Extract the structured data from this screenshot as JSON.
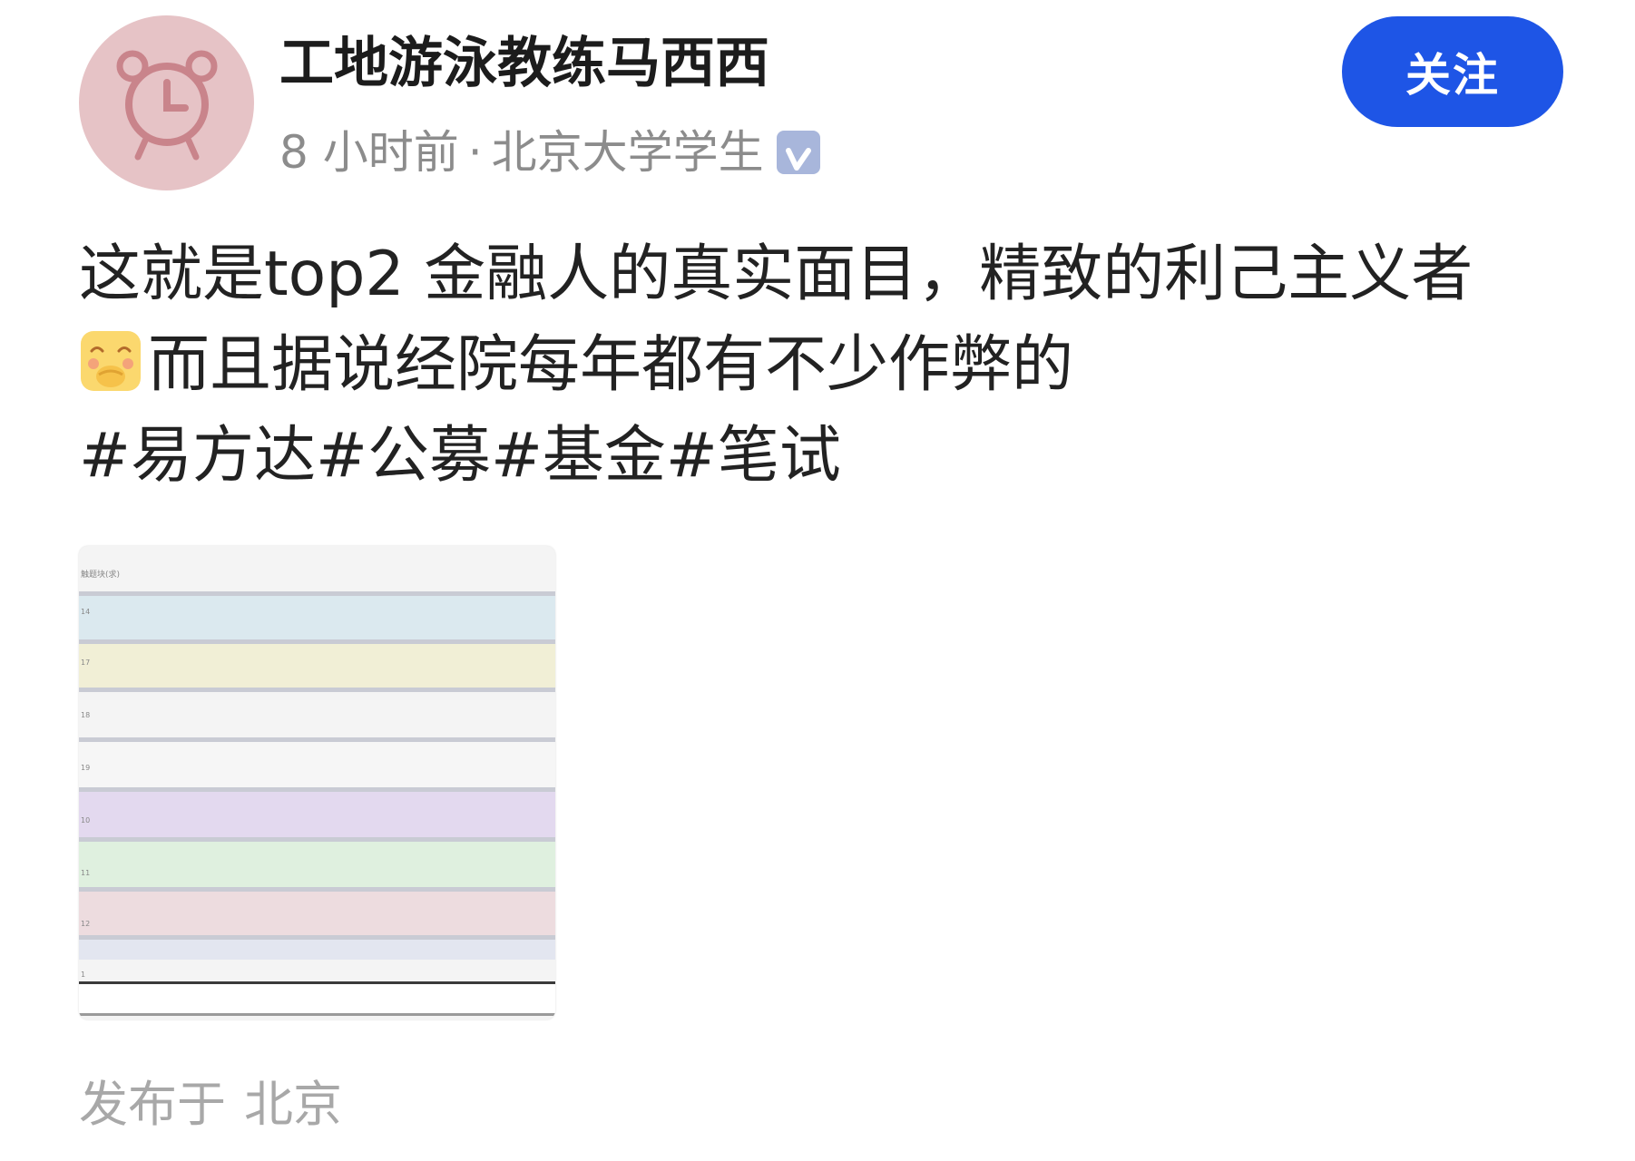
{
  "author": {
    "name": "工地游泳教练马西西",
    "avatar_icon": "alarm-clock-icon",
    "avatar_color": "#e6c3c6"
  },
  "meta": {
    "time": "8 小时前",
    "separator": "·",
    "identity": "北京大学学生",
    "verified_icon": "verified-v-icon"
  },
  "follow_button": {
    "label": "关注",
    "color": "#1e55e6"
  },
  "post": {
    "line1": "这就是top2 金融人的真实面目，精致的利己主义者",
    "emoji_icon": "shy-face-emoji-icon",
    "line2": "而且据说经院每年都有不少作弊的",
    "hashtags": "#易方达#公募#基金#笔试"
  },
  "image": {
    "header_text": "触题块(求)",
    "row_labels": [
      "14",
      "17",
      "18",
      "19",
      "10",
      "11",
      "12",
      "1"
    ],
    "band_colors": [
      "#dbe9ef",
      "#f1efd6",
      "#f4f4f4",
      "#f6f6f6",
      "#e3d9ef",
      "#dff0df",
      "#eddcdf",
      "#e3e6f0"
    ]
  },
  "location": {
    "label": "发布于",
    "place": "北京"
  }
}
